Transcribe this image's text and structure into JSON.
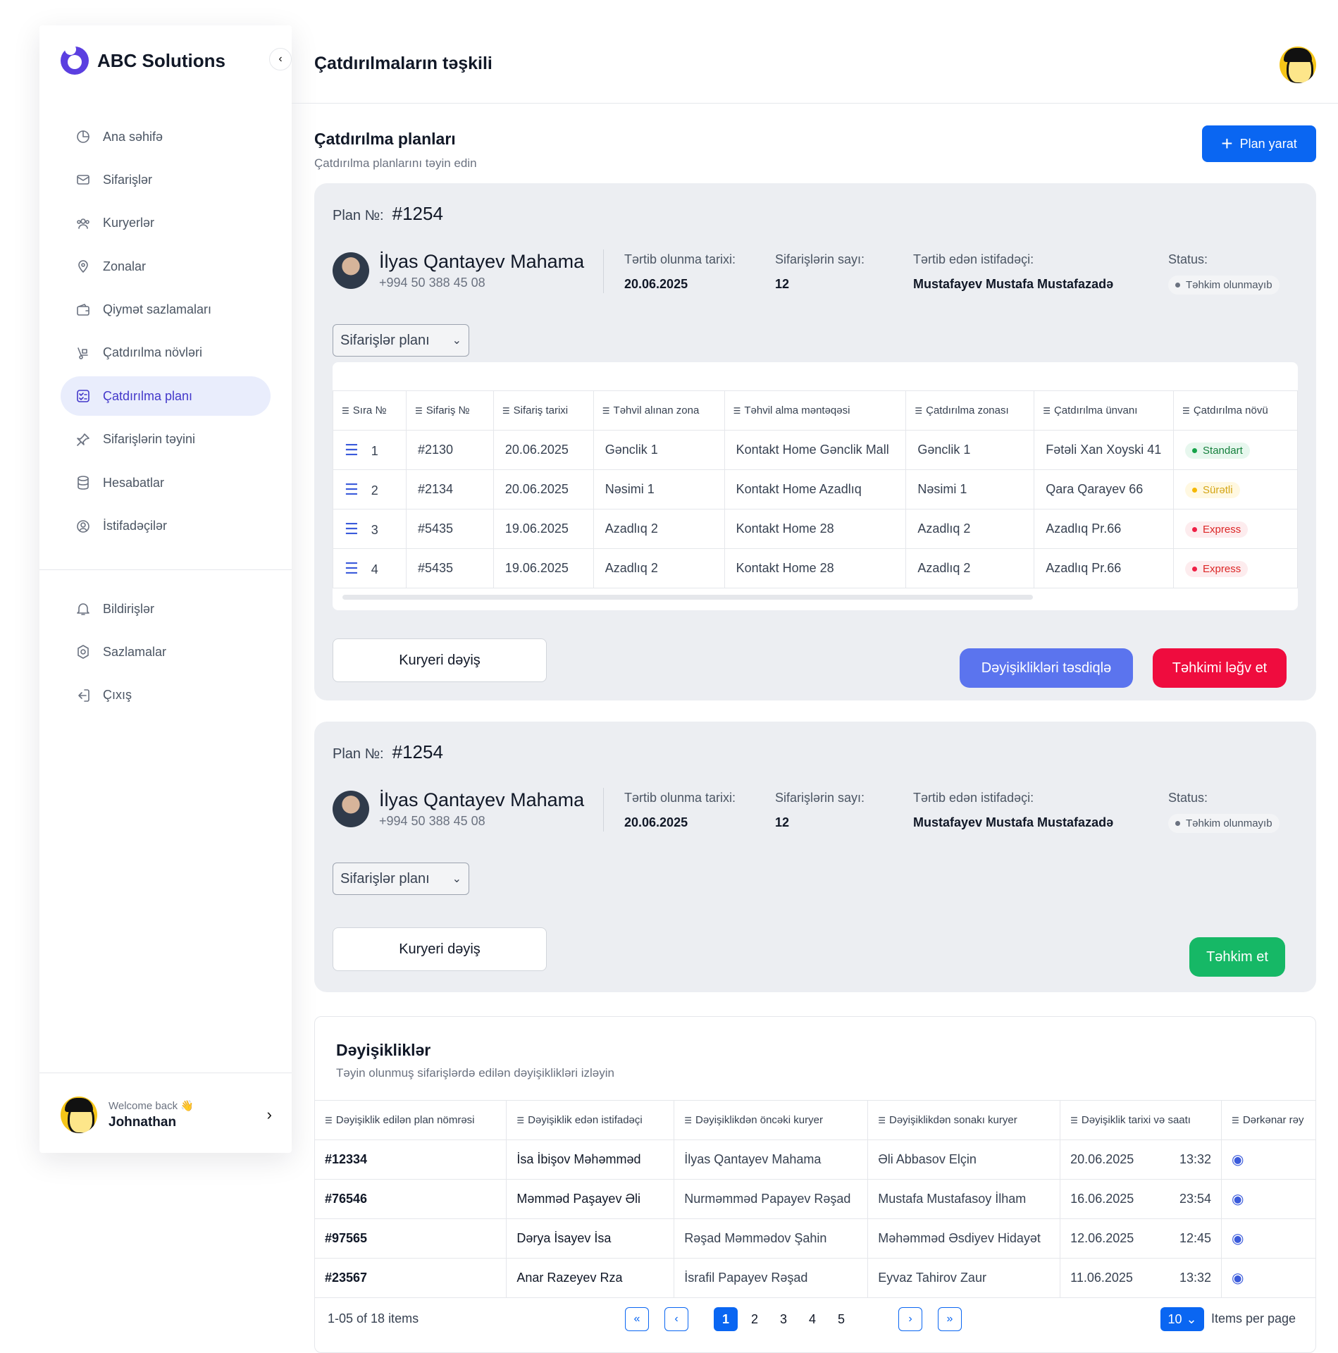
{
  "brand": {
    "name": "ABC Solutions"
  },
  "sidebar": {
    "items": [
      {
        "label": "Ana səhifə",
        "icon": "pie-chart-icon"
      },
      {
        "label": "Sifarişlər",
        "icon": "mail-icon"
      },
      {
        "label": "Kuryerlər",
        "icon": "users-icon"
      },
      {
        "label": "Zonalar",
        "icon": "location-pin-icon"
      },
      {
        "label": "Qiymət sazlamaları",
        "icon": "wallet-icon"
      },
      {
        "label": "Çatdırılma növləri",
        "icon": "delivery-icon"
      },
      {
        "label": "Çatdırılma planı",
        "icon": "checklist-icon",
        "active": true
      },
      {
        "label": "Sifarişlərin təyini",
        "icon": "pin-icon"
      },
      {
        "label": "Hesabatlar",
        "icon": "database-icon"
      },
      {
        "label": "İstifadəçilər",
        "icon": "user-circle-icon"
      }
    ],
    "bottom_items": [
      {
        "label": "Bildirişlər",
        "icon": "bell-icon"
      },
      {
        "label": "Sazlamalar",
        "icon": "settings-icon"
      },
      {
        "label": "Çıxış",
        "icon": "logout-icon"
      }
    ],
    "user": {
      "welcome": "Welcome back 👋",
      "name": "Johnathan"
    }
  },
  "header": {
    "title": "Çatdırılmaların təşkili"
  },
  "page": {
    "title": "Çatdırılma planları",
    "subtitle": "Çatdırılma planlarını təyin edin",
    "create_button": "Plan yarat"
  },
  "plan_labels": {
    "plan_no": "Plan №:",
    "date": "Tərtib olunma tarixi:",
    "count": "Sifarişlərin sayı:",
    "creator": "Tərtib edən istifadəçi:",
    "status": "Status:",
    "select": "Sifarişlər planı",
    "change_courier": "Kuryeri dəyiş",
    "confirm": "Dəyişiklikləri təsdiqlə",
    "cancel": "Təhkimi ləğv et",
    "assign": "Təhkim et"
  },
  "plans": [
    {
      "number": "#1254",
      "courier_name": "İlyas Qantayev Mahama",
      "courier_phone": "+994 50 388 45 08",
      "date": "20.06.2025",
      "count": "12",
      "creator": "Mustafayev Mustafa Mustafazadə",
      "status": "Təhkim olunmayıb"
    },
    {
      "number": "#1254",
      "courier_name": "İlyas Qantayev Mahama",
      "courier_phone": "+994 50 388 45 08",
      "date": "20.06.2025",
      "count": "12",
      "creator": "Mustafayev Mustafa Mustafazadə",
      "status": "Təhkim olunmayıb"
    }
  ],
  "orders_table": {
    "columns": [
      "Sıra №",
      "Sifariş №",
      "Sifariş tarixi",
      "Təhvil alınan zona",
      "Təhvil alma məntəqəsi",
      "Çatdırılma zonası",
      "Çatdırılma ünvanı",
      "Çatdırılma növü"
    ],
    "rows": [
      {
        "seq": "1",
        "order": "#2130",
        "date": "20.06.2025",
        "pickup_zone": "Gənclik 1",
        "pickup_point": "Kontakt Home Gənclik Mall",
        "delivery_zone": "Gənclik 1",
        "address": "Fətəli Xan Xoyski 41",
        "type": "Standart",
        "type_color": "green"
      },
      {
        "seq": "2",
        "order": "#2134",
        "date": "20.06.2025",
        "pickup_zone": "Nəsimi 1",
        "pickup_point": "Kontakt Home Azadlıq",
        "delivery_zone": "Nəsimi 1",
        "address": "Qara Qarayev 66",
        "type": "Sürətli",
        "type_color": "yellow"
      },
      {
        "seq": "3",
        "order": "#5435",
        "date": "19.06.2025",
        "pickup_zone": "Azadlıq 2",
        "pickup_point": "Kontakt Home 28",
        "delivery_zone": "Azadlıq 2",
        "address": "Azadlıq Pr.66",
        "type": "Express",
        "type_color": "red"
      },
      {
        "seq": "4",
        "order": "#5435",
        "date": "19.06.2025",
        "pickup_zone": "Azadlıq 2",
        "pickup_point": "Kontakt Home 28",
        "delivery_zone": "Azadlıq 2",
        "address": "Azadlıq Pr.66",
        "type": "Express",
        "type_color": "red"
      }
    ]
  },
  "changes": {
    "title": "Dəyişikliklər",
    "subtitle": "Təyin olunmuş sifarişlərdə edilən dəyişiklikləri izləyin",
    "columns": [
      "Dəyişiklik edilən plan nömrəsi",
      "Dəyişiklik edən istifadəçi",
      "Dəyişiklikdən öncəki kuryer",
      "Dəyişiklikdən sonakı kuryer",
      "Dəyişiklik tarixi və saatı",
      "Dərkənar rəy"
    ],
    "rows": [
      {
        "plan": "#12334",
        "user": "İsa İbişov Məhəmməd",
        "before": "İlyas Qantayev Mahama",
        "after": "Əli Abbasov Elçin",
        "date": "20.06.2025",
        "time": "13:32"
      },
      {
        "plan": "#76546",
        "user": "Məmməd Paşayev Əli",
        "before": "Nurməmməd Papayev Rəşad",
        "after": "Mustafa Mustafasoy İlham",
        "date": "16.06.2025",
        "time": "23:54"
      },
      {
        "plan": "#97565",
        "user": "Dərya İsayev İsa",
        "before": "Rəşad Məmmədov Şahin",
        "after": "Məhəmməd Əsdiyev Hidayət",
        "date": "12.06.2025",
        "time": "12:45"
      },
      {
        "plan": "#23567",
        "user": "Anar Razeyev Rza",
        "before": "İsrafil Papayev Rəşad",
        "after": "Eyvaz Tahirov Zaur",
        "date": "11.06.2025",
        "time": "13:32"
      }
    ],
    "pagination": {
      "info": "1-05 of 18 items",
      "pages": [
        "1",
        "2",
        "3",
        "4",
        "5"
      ],
      "current": "1",
      "per_page": "10",
      "per_page_label": "Items per page"
    }
  },
  "colors": {
    "accent": "#0a66f2",
    "active_nav_bg": "#e9edfc",
    "confirm": "#5b74ee",
    "cancel": "#ef0c3e",
    "assign": "#16b866"
  }
}
